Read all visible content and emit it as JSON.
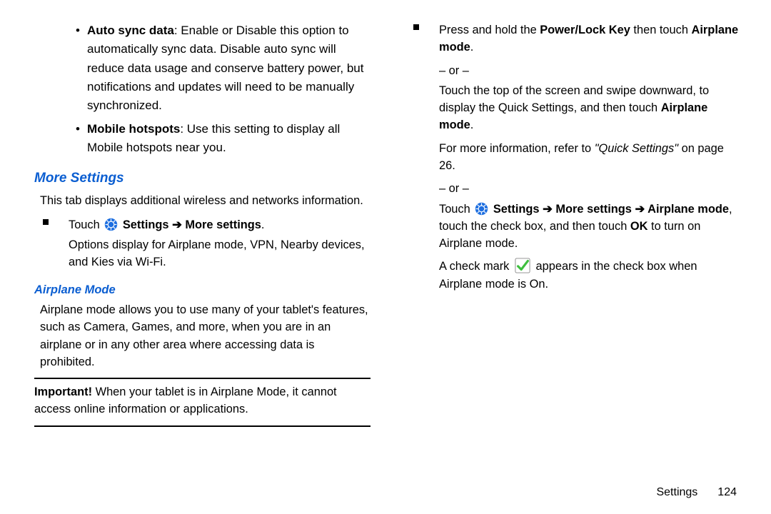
{
  "left": {
    "autosync": {
      "label": "Auto sync data",
      "text": ": Enable or Disable this option to automatically sync data. Disable auto sync will reduce data usage and conserve battery power, but notifications and updates will need to be manually synchronized."
    },
    "hotspots": {
      "label": "Mobile hotspots",
      "text": ": Use this setting to display all Mobile hotspots near you."
    },
    "moreSettingsHeading": "More Settings",
    "moreSettingsIntro": "This tab displays additional wireless and networks information.",
    "touchWord": "Touch ",
    "settingsPath": " Settings ➔ More settings",
    "optionsLine": "Options display for Airplane mode, VPN, Nearby devices, and Kies via Wi-Fi.",
    "airplaneHeading": "Airplane Mode",
    "airplaneBody": "Airplane mode allows you to use many of your tablet's features, such as Camera, Games, and more, when you are in an airplane or in any other area where accessing data is prohibited.",
    "importantLabel": "Important! ",
    "importantBody": "When your tablet is in Airplane Mode, it cannot access online information or applications."
  },
  "right": {
    "pressHold1": "Press and hold the ",
    "powerLock": "Power/Lock Key",
    "pressHold2": " then touch ",
    "airplaneModeBold": "Airplane mode",
    "or": "– or –",
    "swipe1": "Touch the top of the screen and swipe downward, to display the Quick Settings, and then touch ",
    "moreInfo1": "For more information, refer to ",
    "quickSettingsQuoted": "\"Quick Settings\"",
    "moreInfo2": " on page 26.",
    "touchWord": "Touch ",
    "pathFull": " Settings ➔ More settings ➔ Airplane mode",
    "touchCheckbox": ", touch the check box, and then touch ",
    "okBold": "OK",
    "toTurnOn": " to turn on Airplane mode.",
    "checkAppears1": "A check mark ",
    "checkAppears2": " appears in the check box when Airplane mode is On."
  },
  "footer": {
    "chapter": "Settings",
    "page": "124"
  }
}
